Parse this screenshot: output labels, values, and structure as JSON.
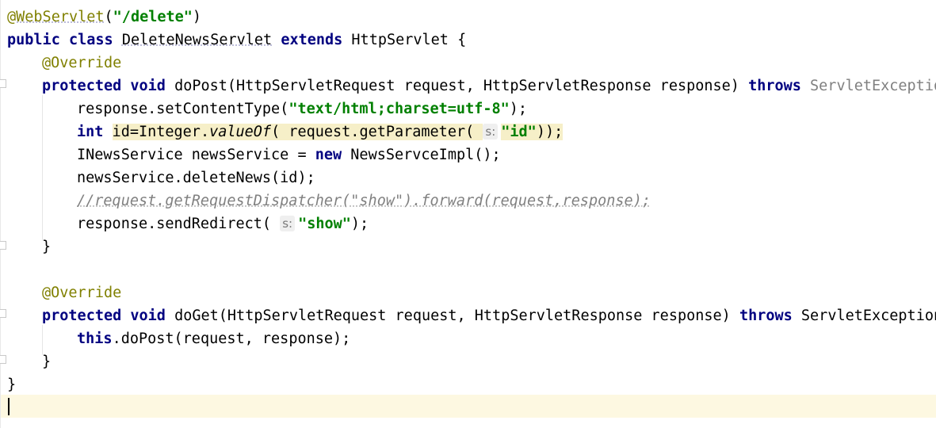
{
  "editor": {
    "lines": {
      "l1": {
        "annotation": "@WebServlet",
        "open": "(",
        "string": "\"/delete\"",
        "close": ")"
      },
      "l2": {
        "kw1": "public",
        "kw2": "class",
        "name": "DeleteNewsServlet",
        "kw3": "extends",
        "parent": "HttpServlet {"
      },
      "l3": {
        "annotation": "@Override"
      },
      "l4": {
        "kw1": "protected",
        "kw2": "void",
        "sig": "doPost(HttpServletRequest request, HttpServletResponse response)",
        "kw3": "throws",
        "exc": "ServletException"
      },
      "l5": {
        "pre": "response.setContentType(",
        "string": "\"text/html;charset=utf-8\"",
        "post": ");"
      },
      "l6": {
        "kw": "int",
        "pre": "id=Integer.",
        "method": "valueOf",
        "mid": "( request.getParameter(",
        "hint": "s:",
        "string": "\"id\"",
        "post": "));"
      },
      "l7": {
        "pre": "INewsService newsService = ",
        "kw": "new",
        "post": "NewsServceImpl();"
      },
      "l8": {
        "text": "newsService.deleteNews(id);"
      },
      "l9": {
        "comment": "//request.getRequestDispatcher(\"show\").forward(request,response);"
      },
      "l10": {
        "pre": "response.sendRedirect(",
        "hint": "s:",
        "string": "\"show\"",
        "post": ");"
      },
      "l11": {
        "text": "}"
      },
      "l13": {
        "annotation": "@Override"
      },
      "l14": {
        "kw1": "protected",
        "kw2": "void",
        "sig": "doGet(HttpServletRequest request, HttpServletResponse response)",
        "kw3": "throws",
        "exc": "ServletException,"
      },
      "l15": {
        "kw": "this",
        "post": ".doPost(request, response);"
      },
      "l16": {
        "text": "}"
      },
      "l17": {
        "text": "}"
      }
    }
  }
}
